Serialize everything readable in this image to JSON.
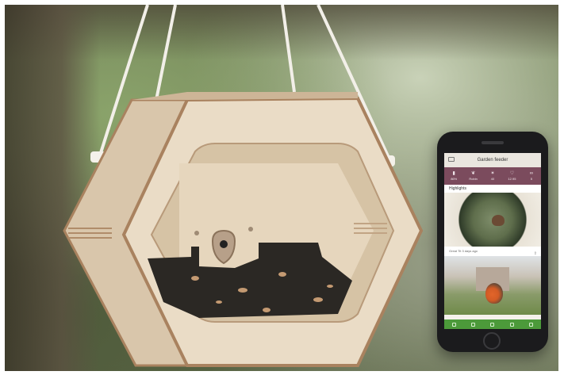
{
  "app": {
    "title": "Garden feeder",
    "stats": [
      {
        "icon": "feed-level-icon",
        "value": "86%"
      },
      {
        "icon": "bird-icon",
        "value": "Robin"
      },
      {
        "icon": "temperature-icon",
        "value": "40"
      },
      {
        "icon": "heart-icon",
        "value": "12.95"
      },
      {
        "icon": "binoculars-icon",
        "value": "5"
      }
    ],
    "highlights_label": "Highlights",
    "photo_caption": "Great Tit 3 days ago",
    "tabbar_icons": [
      "home-icon",
      "feeder-icon",
      "camera-icon",
      "stats-icon",
      "settings-icon"
    ]
  },
  "colors": {
    "stats_bar": "#7b4b5d",
    "tab_bar": "#4c9a3a",
    "wood": "#e8d9c4",
    "wood_edge": "#b28b6a",
    "seed": "#2b2824"
  }
}
